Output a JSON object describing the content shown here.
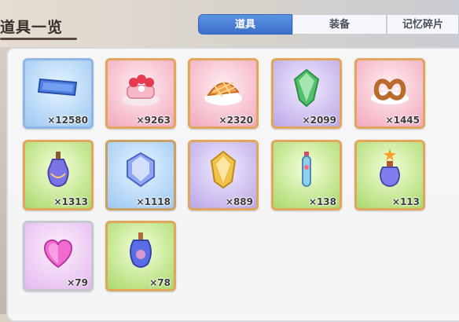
{
  "header": {
    "title": "道具一览"
  },
  "tabs": [
    {
      "label": "道具",
      "active": true
    },
    {
      "label": "装备",
      "active": false
    },
    {
      "label": "记忆碎片",
      "active": false
    }
  ],
  "items": [
    {
      "icon": "ticket-icon",
      "count": "×12580"
    },
    {
      "icon": "strawberry-cake-icon",
      "count": "×9263"
    },
    {
      "icon": "apple-pie-icon",
      "count": "×2320"
    },
    {
      "icon": "green-crystal-icon",
      "count": "×2099"
    },
    {
      "icon": "pretzel-icon",
      "count": "×1445"
    },
    {
      "icon": "potion-flask-icon",
      "count": "×1313"
    },
    {
      "icon": "blue-crystal-icon",
      "count": "×1118"
    },
    {
      "icon": "gold-crystal-icon",
      "count": "×889"
    },
    {
      "icon": "vial-icon",
      "count": "×138"
    },
    {
      "icon": "star-flask-icon",
      "count": "×113"
    },
    {
      "icon": "heart-gem-icon",
      "count": "×79"
    },
    {
      "icon": "small-flask-icon",
      "count": "×78"
    }
  ]
}
